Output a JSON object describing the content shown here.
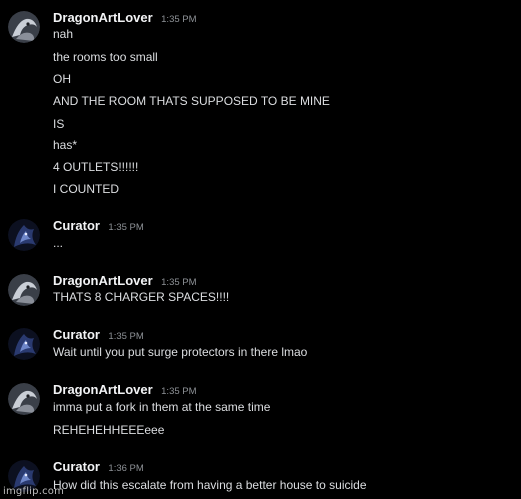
{
  "messages": [
    {
      "author": "DragonArtLover",
      "time": "1:35 PM",
      "avatar_icon": "dragon-avatar-icon",
      "lines": [
        "nah",
        "the rooms too small",
        "OH",
        "AND THE ROOM THATS SUPPOSED TO BE MINE",
        "IS",
        "has*",
        "4 OUTLETS!!!!!!",
        "I COUNTED"
      ]
    },
    {
      "author": "Curator",
      "time": "1:35 PM",
      "avatar_icon": "curator-avatar-icon",
      "lines": [
        "..."
      ]
    },
    {
      "author": "DragonArtLover",
      "time": "1:35 PM",
      "avatar_icon": "dragon-avatar-icon",
      "lines": [
        "THATS 8 CHARGER SPACES!!!!"
      ]
    },
    {
      "author": "Curator",
      "time": "1:35 PM",
      "avatar_icon": "curator-avatar-icon",
      "lines": [
        "Wait until you put surge protectors in there lmao"
      ]
    },
    {
      "author": "DragonArtLover",
      "time": "1:35 PM",
      "avatar_icon": "dragon-avatar-icon",
      "lines": [
        "imma put a fork in them at the same time",
        "REHEHEHHEEEeee"
      ]
    },
    {
      "author": "Curator",
      "time": "1:36 PM",
      "avatar_icon": "curator-avatar-icon",
      "lines": [
        "How did this escalate from having a better house to suicide"
      ]
    }
  ],
  "watermark": "imgflip.com",
  "colors": {
    "background": "#000000",
    "username": "#f2f3f5",
    "timestamp": "#8e9297",
    "message_text": "#dcdee1"
  }
}
